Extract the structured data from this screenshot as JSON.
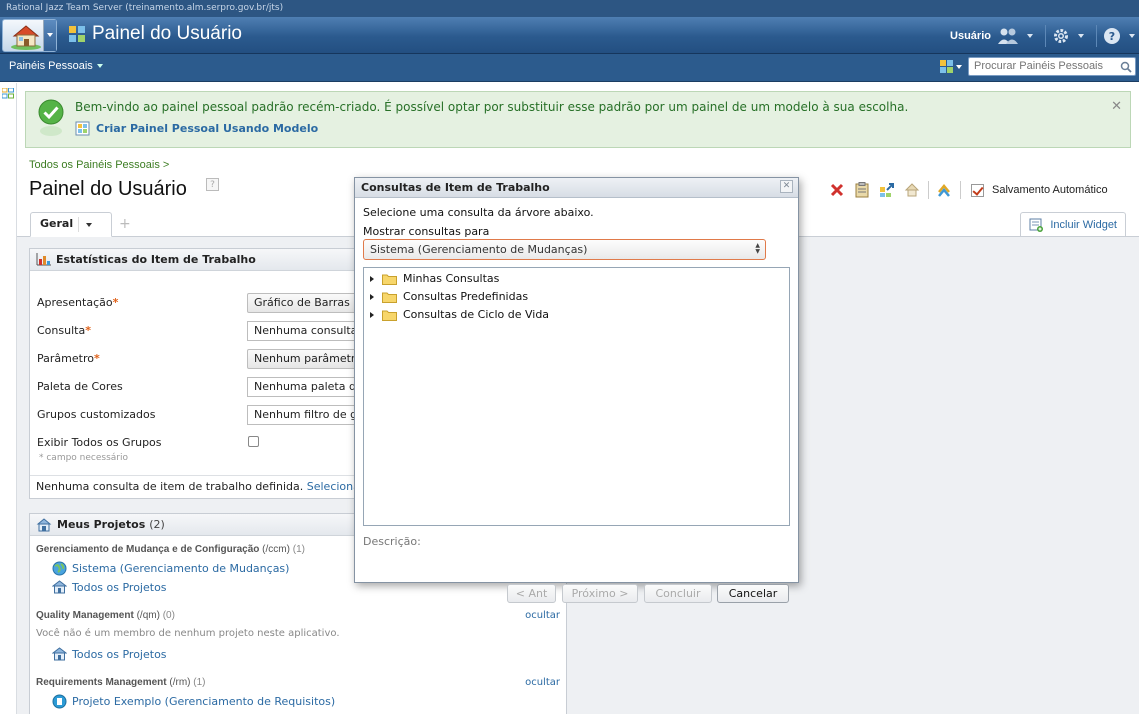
{
  "app": {
    "window_title": "Rational Jazz Team Server (treinamento.alm.serpro.gov.br/jts)",
    "banner_title": "Painel do Usuário",
    "user_label": "Usuário"
  },
  "subnav": {
    "menu_label": "Painéis Pessoais",
    "search_placeholder": "Procurar Painéis Pessoais"
  },
  "welcome": {
    "message": "Bem-vindo ao painel pessoal padrão recém-criado. É possível optar por substituir esse padrão por um painel de um modelo à sua escolha.",
    "link_label": "Criar Painel Pessoal Usando Modelo",
    "close_glyph": "✕"
  },
  "page": {
    "breadcrumb": "Todos os Painéis Pessoais >",
    "title": "Painel do Usuário",
    "help_glyph": "?",
    "autosave_label": "Salvamento Automático"
  },
  "tabs": {
    "active_tab": "Geral",
    "add_glyph": "+",
    "add_widget_label": "Incluir Widget"
  },
  "stats_widget": {
    "title": "Estatísticas do Item de Trabalho",
    "required_mark": "*",
    "fields": [
      {
        "label": "Apresentação",
        "value": "Gráfico de Barras"
      },
      {
        "label": "Consulta",
        "value": "Nenhuma consulta selecionada"
      },
      {
        "label": "Parâmetro",
        "value": "Nenhum parâmetro selecionado"
      },
      {
        "label": "Paleta de Cores",
        "value": "Nenhuma paleta de cores"
      },
      {
        "label": "Grupos customizados",
        "value": "Nenhum filtro de grupos"
      },
      {
        "label": "Exibir Todos os Grupos"
      }
    ],
    "note": "* campo necessário",
    "footer_text": "Nenhuma consulta de item de trabalho definida.",
    "footer_link": "Selecionar"
  },
  "projects_widget": {
    "title": "Meus Projetos",
    "count": "(2)",
    "groups": [
      {
        "name": "Gerenciamento de Mudança e de Configuração",
        "path": "(/ccm)",
        "count": "(1)"
      },
      {
        "name": "Quality Management",
        "path": "(/qm)",
        "count": "(0)",
        "hide_label": "ocultar"
      },
      {
        "name": "Requirements Management",
        "path": "(/rm)",
        "count": "(1)",
        "hide_label": "ocultar"
      }
    ],
    "items": [
      "Sistema (Gerenciamento de Mudanças)",
      "Todos os Projetos",
      "Todos os Projetos",
      "Projeto Exemplo (Gerenciamento de Requisitos)"
    ],
    "qm_note": "Você não é um membro de nenhum projeto neste aplicativo."
  },
  "dialog": {
    "title": "Consultas de Item de Trabalho",
    "close_glyph": "✕",
    "instruction": "Selecione uma consulta da árvore abaixo.",
    "show_for_label": "Mostrar consultas para",
    "selected_source": "Sistema (Gerenciamento de Mudanças)",
    "tree": [
      "Minhas Consultas",
      "Consultas Predefinidas",
      "Consultas de Ciclo de Vida"
    ],
    "description_label": "Descrição:",
    "buttons": {
      "prev": "< Ant",
      "next": "Próximo >",
      "finish": "Concluir",
      "cancel": "Cancelar"
    }
  },
  "colors": {
    "banner": "#2b5a8e",
    "link": "#2b6aa3",
    "welcome_text": "#277027",
    "required": "#e0621a"
  }
}
